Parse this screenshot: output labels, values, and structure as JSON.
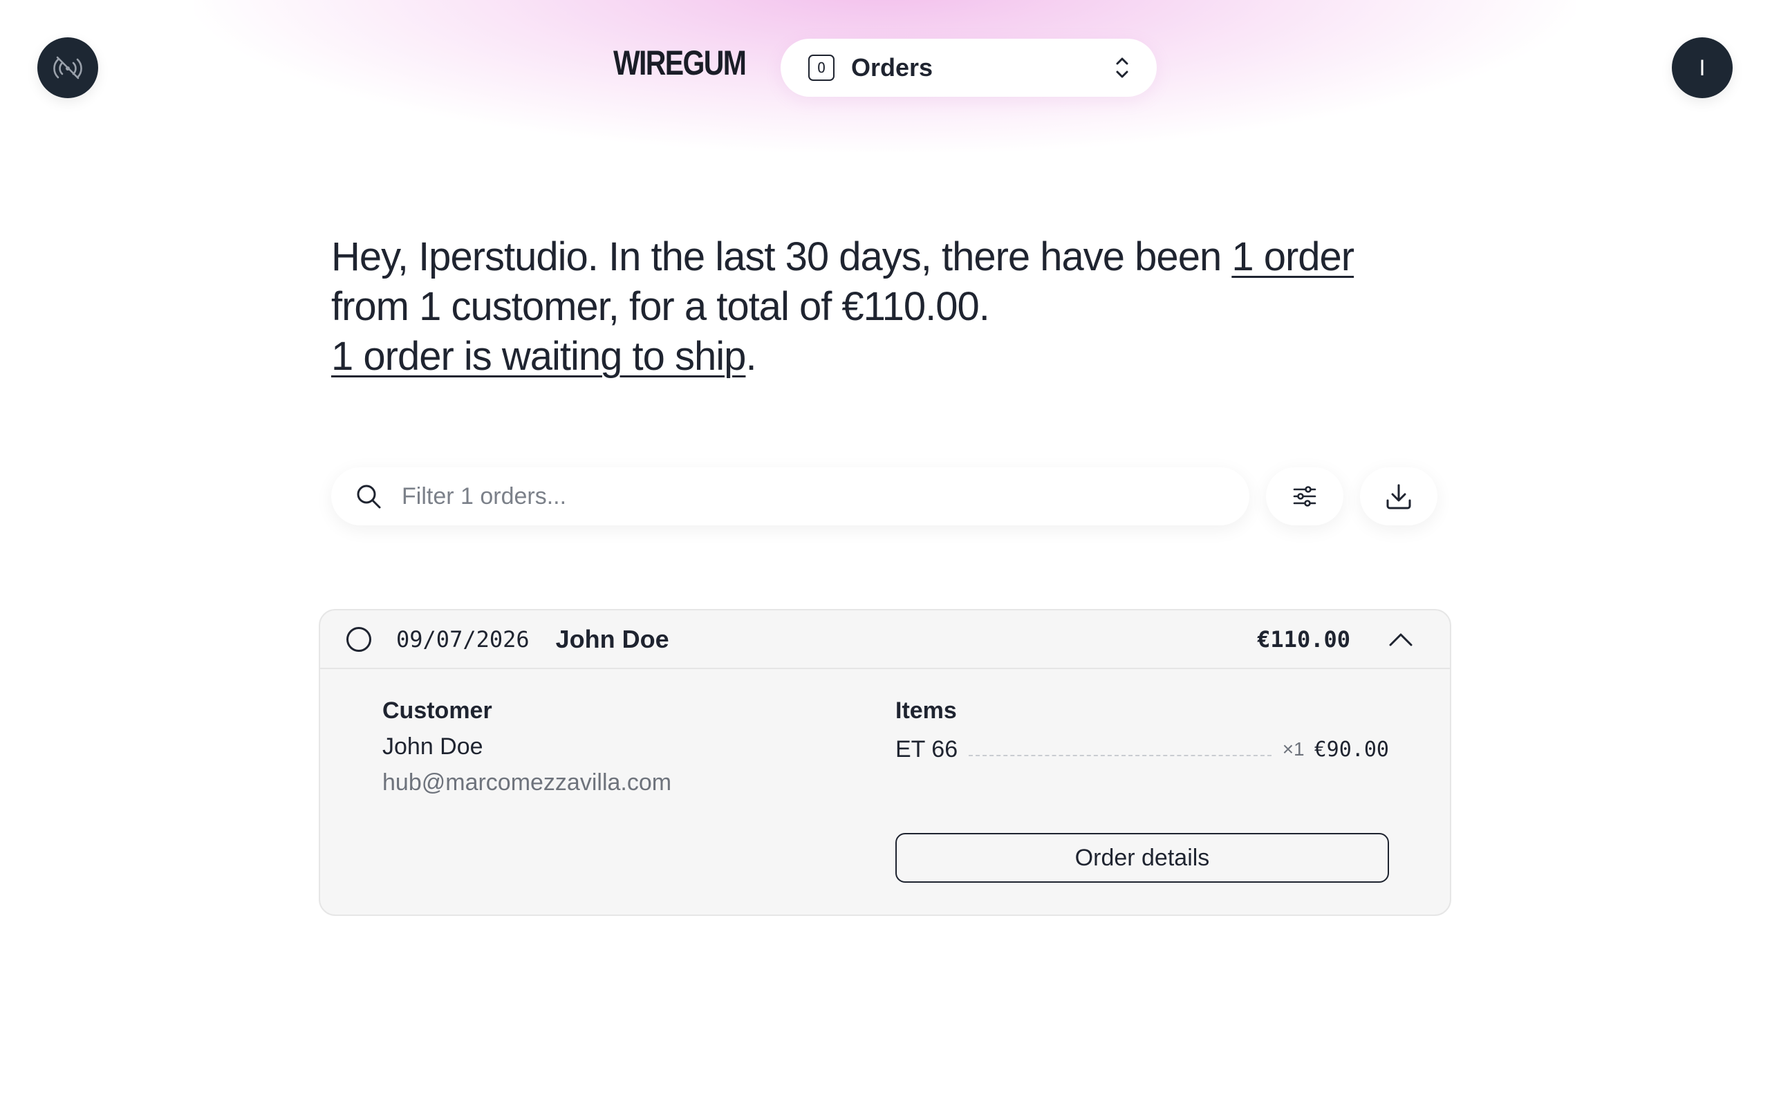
{
  "header": {
    "logo": "WIREGUM",
    "selector": {
      "shortcut": "O",
      "label": "Orders"
    },
    "avatar_initial": "I",
    "left_icon": "signal-off-icon"
  },
  "summary": {
    "line1_prefix": "Hey, Iperstudio. In the last 30 days, there have been ",
    "line1_link": "1 order",
    "line2": "from 1 customer, for a total of €110.00.",
    "line3_link": "1 order is waiting to ship",
    "line3_suffix": "."
  },
  "search": {
    "placeholder": "Filter 1 orders..."
  },
  "toolbar": {
    "filter_icon": "sliders-icon",
    "download_icon": "download-icon"
  },
  "order": {
    "date": "09/07/2026",
    "customer_name": "John Doe",
    "total": "€110.00",
    "customer_label": "Customer",
    "customer_display": "John Doe",
    "customer_email": "hub@marcomezzavilla.com",
    "items_label": "Items",
    "items": [
      {
        "name": "ET 66",
        "qty": "×1",
        "price": "€90.00"
      }
    ],
    "details_button": "Order details"
  },
  "colors": {
    "dark": "#1d2733",
    "text": "#1f2430",
    "muted": "#6e737c",
    "glow": "#f3c4ee",
    "card": "#f6f6f6"
  }
}
